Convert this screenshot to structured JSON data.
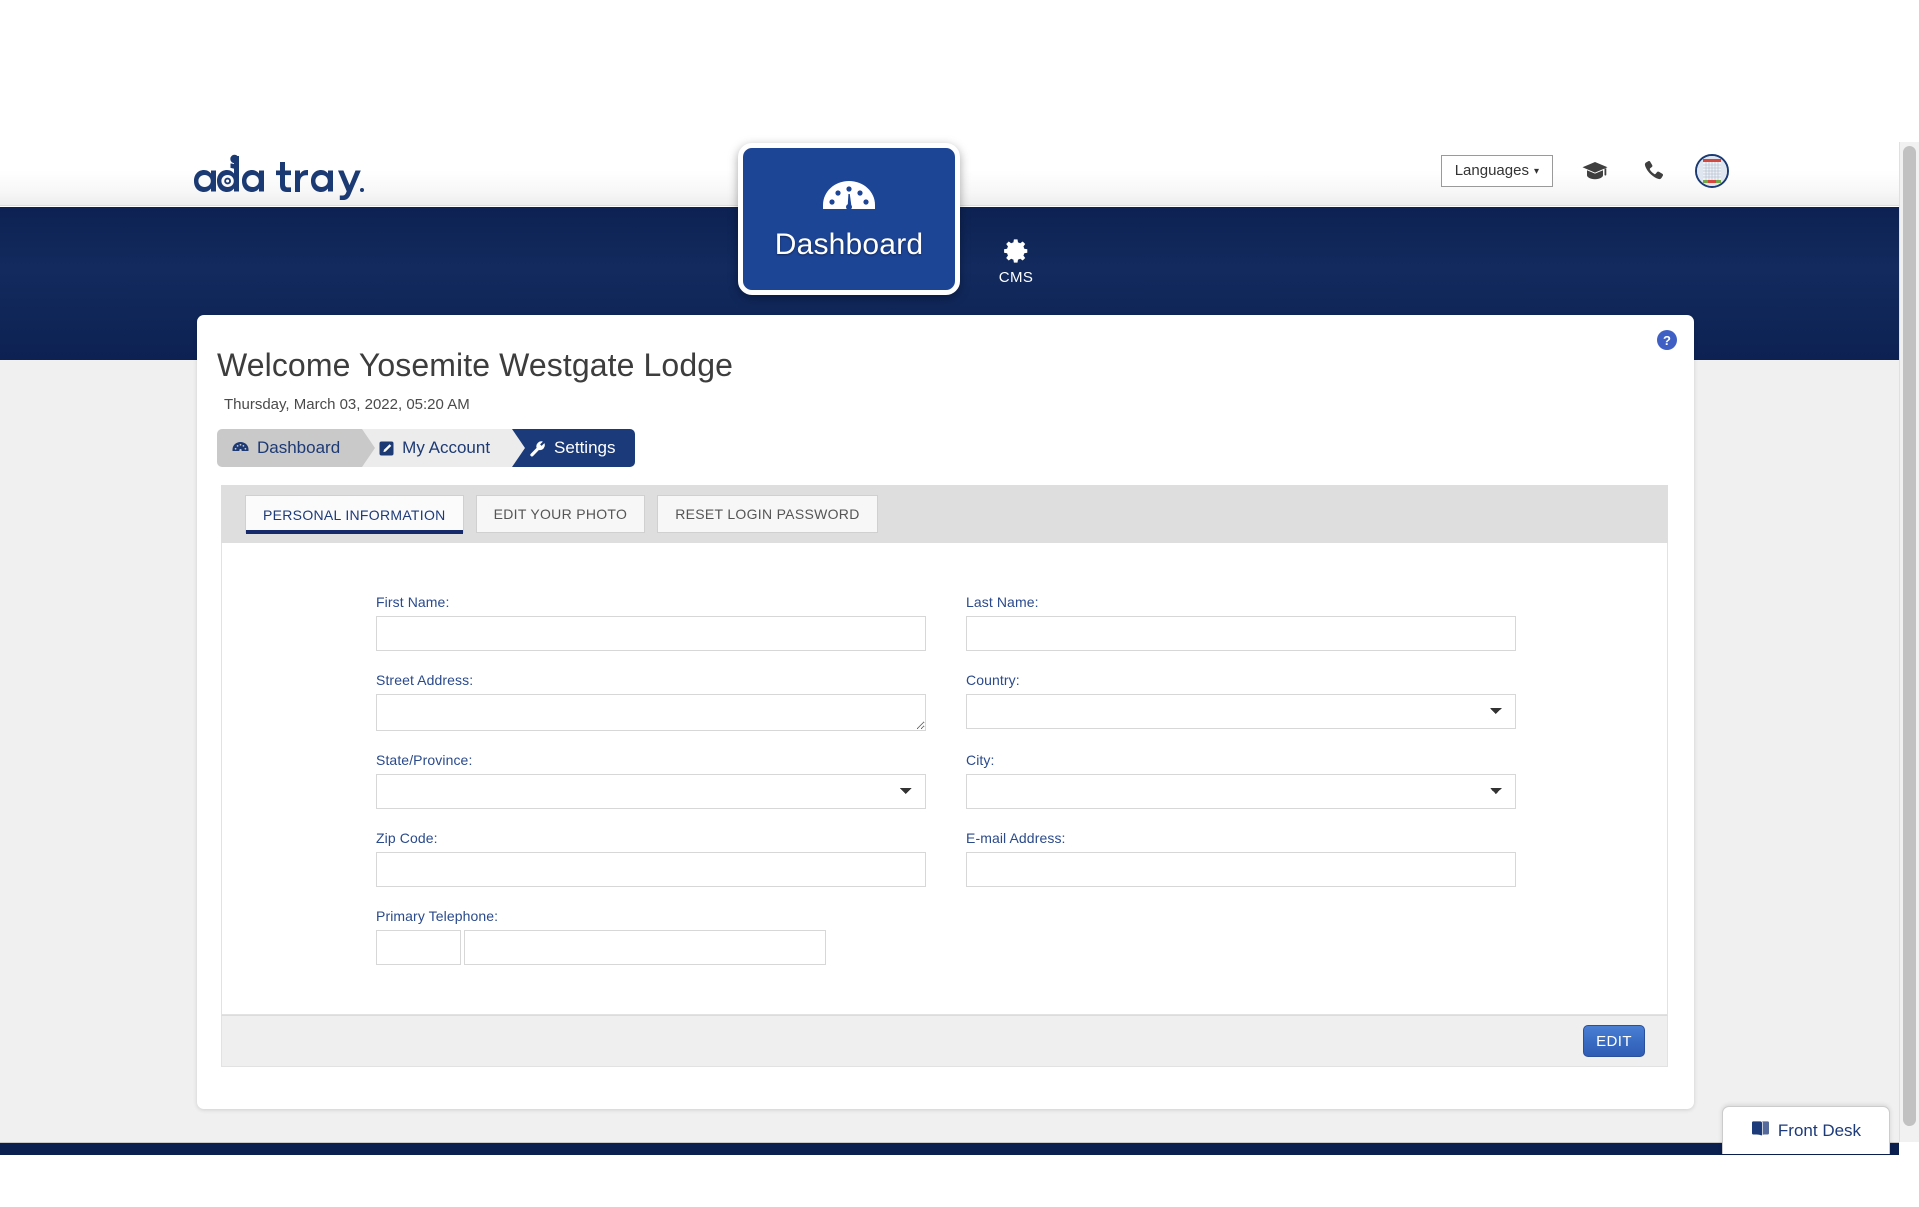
{
  "header": {
    "logo_text": "ada tray",
    "languages_label": "Languages",
    "caret": "▾",
    "icons": {
      "graduation": "graduation-cap-icon",
      "phone": "phone-icon",
      "avatar": "building-avatar"
    }
  },
  "nav": {
    "dashboard_label": "Dashboard",
    "cms_label": "CMS"
  },
  "page": {
    "title": "Welcome Yosemite Westgate Lodge",
    "datetime": "Thursday, March 03, 2022, 05:20 AM",
    "help_label": "?"
  },
  "breadcrumb": [
    {
      "label": "Dashboard",
      "icon": "gauge-icon"
    },
    {
      "label": "My Account",
      "icon": "edit-icon"
    },
    {
      "label": "Settings",
      "icon": "wrench-icon"
    }
  ],
  "tabs": [
    {
      "label": "PERSONAL INFORMATION",
      "active": true
    },
    {
      "label": "EDIT YOUR PHOTO",
      "active": false
    },
    {
      "label": "RESET LOGIN PASSWORD",
      "active": false
    }
  ],
  "form": {
    "first_name": {
      "label": "First Name:",
      "value": "",
      "placeholder": ""
    },
    "last_name": {
      "label": "Last Name:",
      "value": "",
      "placeholder": ""
    },
    "street_address": {
      "label": "Street Address:",
      "value": "",
      "placeholder": ""
    },
    "country": {
      "label": "Country:",
      "value": "",
      "options": [
        ""
      ]
    },
    "state_province": {
      "label": "State/Province:",
      "value": "",
      "options": [
        ""
      ]
    },
    "city": {
      "label": "City:",
      "value": "",
      "options": [
        ""
      ]
    },
    "zip_code": {
      "label": "Zip Code:",
      "value": "",
      "placeholder": ""
    },
    "email": {
      "label": "E-mail Address:",
      "value": "",
      "placeholder": ""
    },
    "primary_telephone": {
      "label": "Primary Telephone:",
      "area_value": "",
      "number_value": ""
    }
  },
  "footer": {
    "edit_label": "EDIT"
  },
  "widget": {
    "front_desk_label": "Front Desk"
  },
  "colors": {
    "navy": "#0d2252",
    "accent_blue": "#1d4596",
    "label_blue": "#2a4a8c",
    "active_crumb": "#1a3a79",
    "tab_underline": "#16296b",
    "page_bg": "#f0f0f0"
  }
}
